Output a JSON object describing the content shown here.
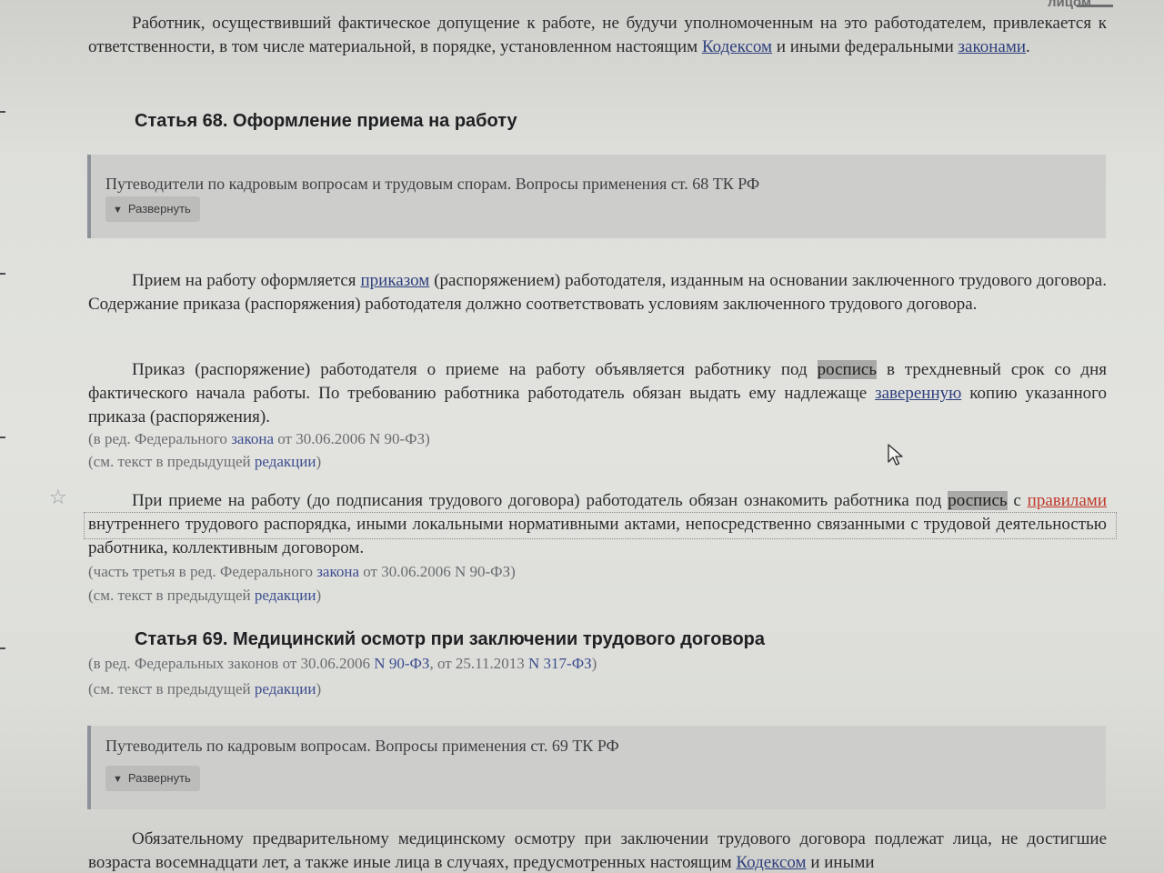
{
  "top_fragment": "лицом",
  "para_intro": {
    "text_a": "Работник, осуществивший фактическое допущение к работе, не будучи уполномоченным на это работодателем, привлекается к ответственности, в том числе материальной, в порядке, установленном настоящим ",
    "link_codex": "Кодексом",
    "text_b": " и иными федеральными ",
    "link_laws": "законами",
    "text_c": "."
  },
  "article68": {
    "heading": "Статья 68. Оформление приема на работу",
    "guide_title": "Путеводители по кадровым вопросам и трудовым спорам. Вопросы применения ст. 68 ТК РФ",
    "expand_label": "Развернуть",
    "p1": {
      "text_a": "Прием на работу оформляется ",
      "link_order": "приказом",
      "text_b": " (распоряжением) работодателя, изданным на основании заключенного трудового договора. Содержание приказа (распоряжения) работодателя должно соответствовать условиям заключенного трудового договора."
    },
    "p2": {
      "text_a": "Приказ (распоряжение) работодателя о приеме на работу объявляется работнику под ",
      "highlight": "роспись",
      "text_b": " в трехдневный срок со дня фактического начала работы. По требованию работника работодатель обязан выдать ему надлежаще ",
      "link_certified": "заверенную",
      "text_c": " копию указанного приказа (распоряжения)."
    },
    "note1": {
      "text_a": "(в ред. Федерального ",
      "link": "закона",
      "text_b": " от 30.06.2006 N 90-ФЗ)"
    },
    "note2": {
      "text_a": "(см. текст в предыдущей ",
      "link": "редакции",
      "text_b": ")"
    },
    "p3": {
      "text_a": "При приеме на работу (до подписания трудового договора) работодатель обязан ознакомить работника под ",
      "highlight": "роспись",
      "text_b": " с ",
      "link_rules": "правилами",
      "text_c": " внутреннего трудового распорядка, иными локальными нормативными актами, непосредственно связанными с трудовой деятельностью работника, коллективным договором."
    },
    "note3": {
      "text_a": "(часть третья в ред. Федерального ",
      "link": "закона",
      "text_b": " от 30.06.2006 N 90-ФЗ)"
    },
    "note4": {
      "text_a": "(см. текст в предыдущей ",
      "link": "редакции",
      "text_b": ")"
    }
  },
  "article69": {
    "heading": "Статья 69. Медицинский осмотр при заключении трудового договора",
    "note1": {
      "text_a": "(в ред. Федеральных законов от 30.06.2006 ",
      "link1": "N 90-ФЗ",
      "text_b": ", от 25.11.2013 ",
      "link2": "N 317-ФЗ",
      "text_c": ")"
    },
    "note2": {
      "text_a": "(см. текст в предыдущей ",
      "link": "редакции",
      "text_b": ")"
    },
    "guide_title": "Путеводитель по кадровым вопросам. Вопросы применения ст. 69 ТК РФ",
    "expand_label": "Развернуть",
    "p1": {
      "text_a": "Обязательному предварительному медицинскому осмотру при заключении трудового договора подлежат лица, не достигшие возраста восемнадцати лет, а также иные лица в случаях, предусмотренных настоящим ",
      "link_codex": "Кодексом",
      "text_b": " и иными"
    }
  }
}
